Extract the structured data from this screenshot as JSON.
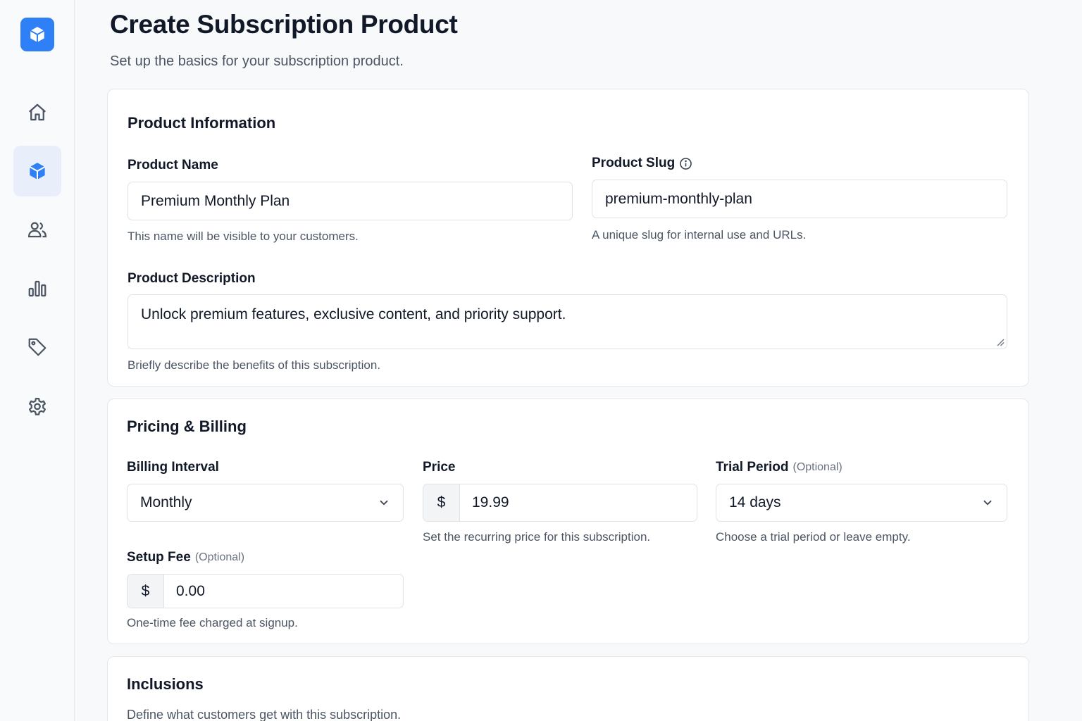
{
  "page": {
    "title": "Create Subscription Product",
    "subtitle": "Set up the basics for your subscription product."
  },
  "sidebar": {
    "items": [
      {
        "icon": "home-icon",
        "active": false
      },
      {
        "icon": "box-icon",
        "active": true
      },
      {
        "icon": "users-icon",
        "active": false
      },
      {
        "icon": "bar-chart-icon",
        "active": false
      },
      {
        "icon": "tag-icon",
        "active": false
      },
      {
        "icon": "gear-icon",
        "active": false
      }
    ],
    "accent": "#2f7ff6"
  },
  "product_info": {
    "title": "Product Information",
    "name_label": "Product Name",
    "name_value": "Premium Monthly Plan",
    "name_hint": "This name will be visible to your customers.",
    "slug_label": "Product Slug",
    "slug_value": "premium-monthly-plan",
    "slug_hint": "A unique slug for internal use and URLs.",
    "description_label": "Product Description",
    "description_value": "Unlock premium features, exclusive content, and priority support.",
    "description_hint": "Briefly describe the benefits of this subscription."
  },
  "pricing": {
    "title": "Pricing & Billing",
    "interval_label": "Billing Interval",
    "interval_value": "Monthly",
    "price_label": "Price",
    "price_currency": "$",
    "price_value": "19.99",
    "price_hint": "Set the recurring price for this subscription.",
    "trial_label": "Trial Period",
    "trial_optional": "(Optional)",
    "trial_value": "14 days",
    "trial_hint": "Choose a trial period or leave empty.",
    "setup_label": "Setup Fee",
    "setup_optional": "(Optional)",
    "setup_currency": "$",
    "setup_value": "0.00",
    "setup_hint": "One-time fee charged at signup."
  },
  "inclusions": {
    "title": "Inclusions",
    "subtitle": "Define what customers get with this subscription."
  }
}
